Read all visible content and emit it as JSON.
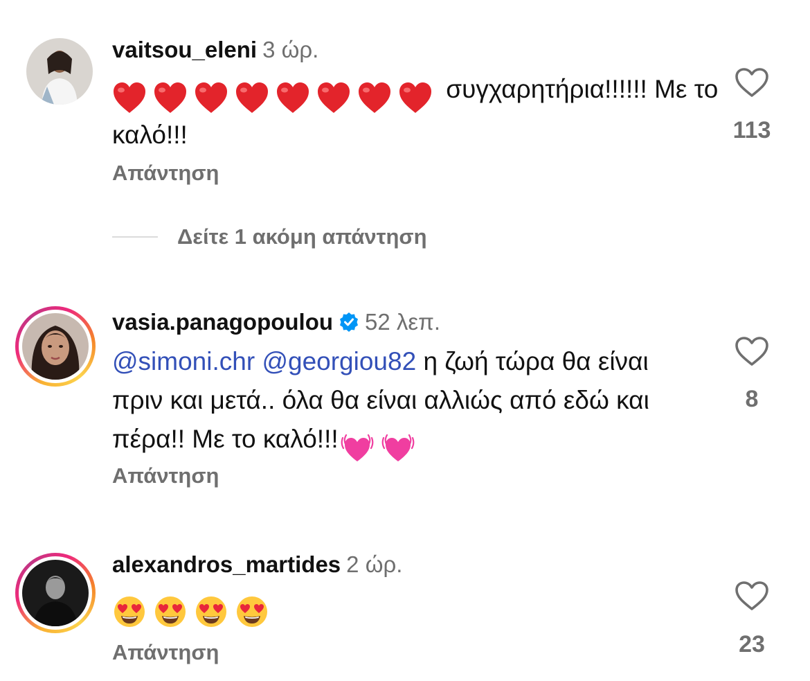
{
  "comments": [
    {
      "username": "vaitsou_eleni",
      "time": "3 ώρ.",
      "verified": false,
      "has_story": false,
      "hearts_emoji_count": 8,
      "text_after_emoji": " συγχαρητήρια!!!!!! Με το καλό!!!",
      "reply_label": "Απάντηση",
      "likes": "113",
      "like_icon": "heart-outline-icon"
    },
    {
      "username": "vasia.panagopoulou",
      "time": "52 λεπ.",
      "verified": true,
      "has_story": true,
      "mention_1": "@simoni.chr",
      "mention_2": "@georgiou82",
      "text": " η ζωή τώρα θα είναι πριν και μετά.. όλα θα είναι αλλιώς από εδώ και πέρα!! Με το καλό!!!",
      "trailing_emoji": "beating-heart-emoji x2",
      "reply_label": "Απάντηση",
      "likes": "8",
      "like_icon": "heart-outline-icon"
    },
    {
      "username": "alexandros_martides",
      "time": "2 ώρ.",
      "verified": false,
      "has_story": true,
      "heart_eyes_emoji_count": 4,
      "reply_label": "Απάντηση",
      "likes": "23",
      "like_icon": "heart-outline-icon"
    }
  ],
  "view_more_replies": "Δείτε 1 ακόμη απάντηση",
  "colors": {
    "mention": "#3350b8",
    "secondary_text": "#6f6f6f",
    "verified_badge": "#0095f6"
  }
}
